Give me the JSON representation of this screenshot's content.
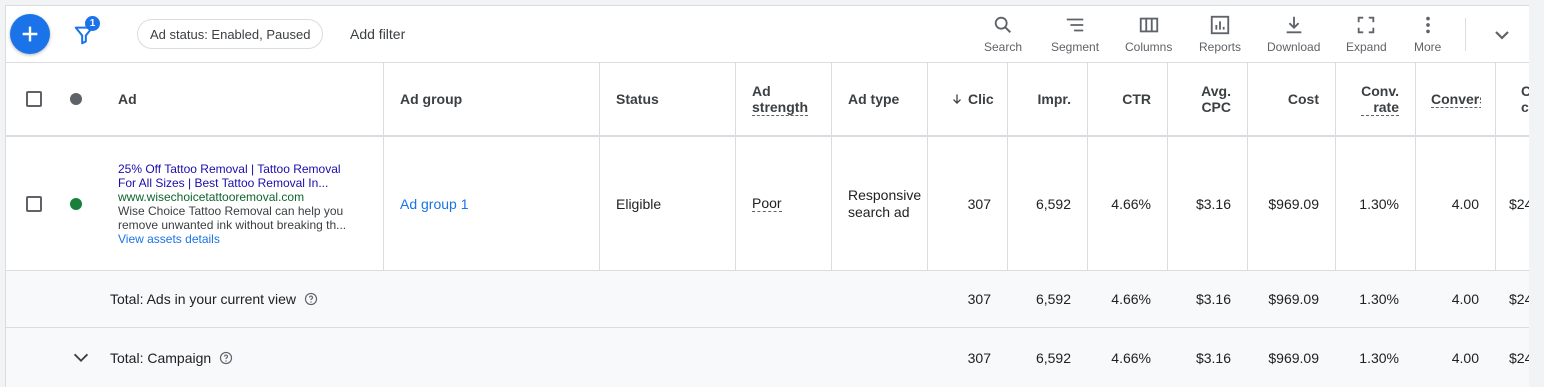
{
  "toolbar": {
    "filter_badge": "1",
    "chip_label": "Ad status: Enabled, Paused",
    "add_filter": "Add filter",
    "tools": [
      {
        "icon": "search-icon",
        "label": "Search"
      },
      {
        "icon": "segment-icon",
        "label": "Segment"
      },
      {
        "icon": "columns-icon",
        "label": "Columns"
      },
      {
        "icon": "reports-icon",
        "label": "Reports"
      },
      {
        "icon": "download-icon",
        "label": "Download"
      },
      {
        "icon": "expand-icon",
        "label": "Expand"
      },
      {
        "icon": "more-icon",
        "label": "More"
      }
    ]
  },
  "table": {
    "headers": {
      "ad": "Ad",
      "ad_group": "Ad group",
      "status": "Status",
      "ad_strength_1": "Ad",
      "ad_strength_2": "strength",
      "ad_type": "Ad type",
      "clicks": "Clic",
      "impr": "Impr.",
      "ctr": "CTR",
      "avg_cpc_1": "Avg.",
      "avg_cpc_2": "CPC",
      "cost": "Cost",
      "conv_rate_1": "Conv.",
      "conv_rate_2": "rate",
      "conversions": "Convers",
      "cut_1": "C",
      "cut_2": "c"
    },
    "row": {
      "ad_headline_1": "25% Off Tattoo Removal | Tattoo Removal",
      "ad_headline_2": "For All Sizes | Best Tattoo Removal In...",
      "ad_url": "www.wisechoicetattooremoval.com",
      "ad_desc_1": "Wise Choice Tattoo Removal can help you",
      "ad_desc_2": "remove unwanted ink without breaking th...",
      "ad_assets_link": "View assets details",
      "ad_group": "Ad group 1",
      "status": "Eligible",
      "ad_strength": "Poor",
      "ad_type_1": "Responsive",
      "ad_type_2": "search ad",
      "clicks": "307",
      "impr": "6,592",
      "ctr": "4.66%",
      "avg_cpc": "$3.16",
      "cost": "$969.09",
      "conv_rate": "1.30%",
      "conversions": "4.00",
      "cut": "$24"
    },
    "total_view": {
      "label": "Total: Ads in your current view",
      "clicks": "307",
      "impr": "6,592",
      "ctr": "4.66%",
      "avg_cpc": "$3.16",
      "cost": "$969.09",
      "conv_rate": "1.30%",
      "conversions": "4.00",
      "cut": "$24"
    },
    "total_campaign": {
      "label": "Total: Campaign",
      "clicks": "307",
      "impr": "6,592",
      "ctr": "4.66%",
      "avg_cpc": "$3.16",
      "cost": "$969.09",
      "conv_rate": "1.30%",
      "conversions": "4.00",
      "cut": "$24"
    }
  },
  "colors": {
    "accent": "#1a73e8",
    "status_eligible": "#188038",
    "status_header": "#5f6368"
  }
}
